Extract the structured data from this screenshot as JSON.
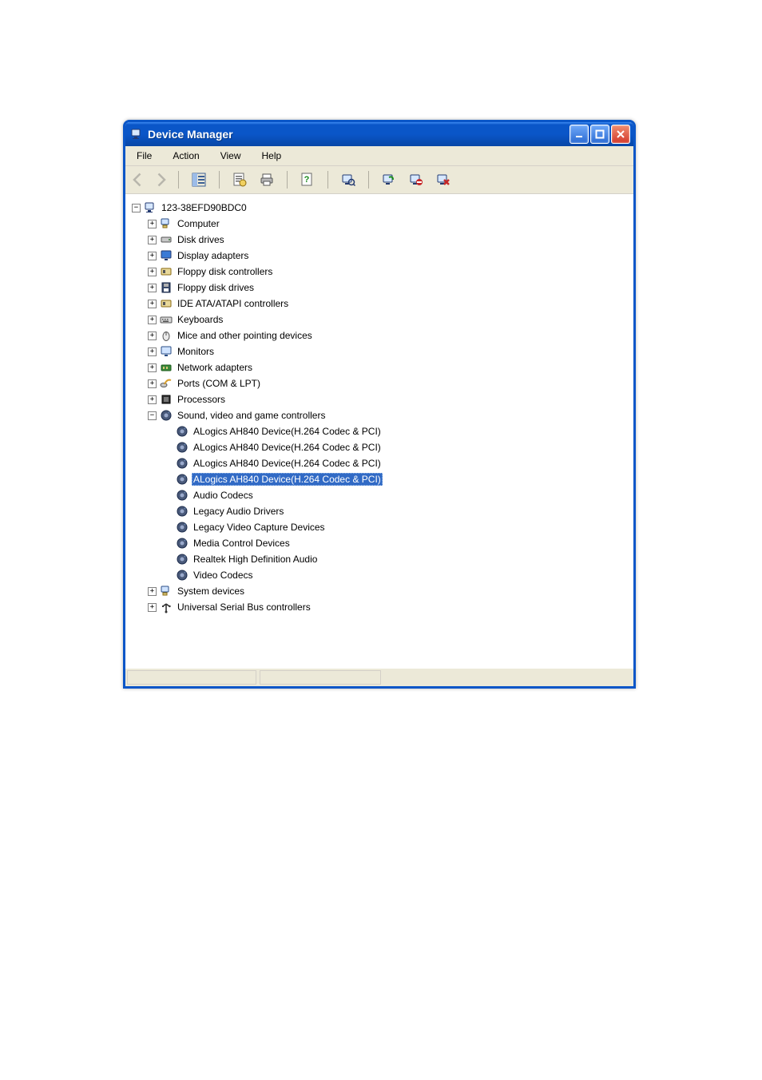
{
  "window": {
    "title": "Device Manager"
  },
  "menubar": {
    "items": [
      "File",
      "Action",
      "View",
      "Help"
    ]
  },
  "toolbar": {
    "icons": [
      "back",
      "forward",
      "show-hide-tree",
      "properties",
      "print",
      "help",
      "scan-hardware",
      "enable",
      "disable",
      "uninstall"
    ]
  },
  "tree": {
    "root": {
      "label": "123-38EFD90BDC0",
      "expanded": true,
      "children": [
        {
          "label": "Computer",
          "icon": "computer",
          "expanded": false
        },
        {
          "label": "Disk drives",
          "icon": "disk",
          "expanded": false
        },
        {
          "label": "Display adapters",
          "icon": "display",
          "expanded": false
        },
        {
          "label": "Floppy disk controllers",
          "icon": "floppy-ctrl",
          "expanded": false
        },
        {
          "label": "Floppy disk drives",
          "icon": "floppy",
          "expanded": false
        },
        {
          "label": "IDE ATA/ATAPI controllers",
          "icon": "ide",
          "expanded": false
        },
        {
          "label": "Keyboards",
          "icon": "keyboard",
          "expanded": false
        },
        {
          "label": "Mice and other pointing devices",
          "icon": "mouse",
          "expanded": false
        },
        {
          "label": "Monitors",
          "icon": "monitor",
          "expanded": false
        },
        {
          "label": "Network adapters",
          "icon": "network",
          "expanded": false
        },
        {
          "label": "Ports (COM & LPT)",
          "icon": "ports",
          "expanded": false
        },
        {
          "label": "Processors",
          "icon": "cpu",
          "expanded": false
        },
        {
          "label": "Sound, video and game controllers",
          "icon": "sound",
          "expanded": true,
          "children": [
            {
              "label": "ALogics AH840 Device(H.264 Codec & PCI)",
              "icon": "sound"
            },
            {
              "label": "ALogics AH840 Device(H.264 Codec & PCI)",
              "icon": "sound"
            },
            {
              "label": "ALogics AH840 Device(H.264 Codec & PCI)",
              "icon": "sound"
            },
            {
              "label": "ALogics AH840 Device(H.264 Codec & PCI)",
              "icon": "sound",
              "selected": true
            },
            {
              "label": "Audio Codecs",
              "icon": "sound"
            },
            {
              "label": "Legacy Audio Drivers",
              "icon": "sound"
            },
            {
              "label": "Legacy Video Capture Devices",
              "icon": "sound"
            },
            {
              "label": "Media Control Devices",
              "icon": "sound"
            },
            {
              "label": "Realtek High Definition Audio",
              "icon": "sound"
            },
            {
              "label": "Video Codecs",
              "icon": "sound"
            }
          ]
        },
        {
          "label": "System devices",
          "icon": "system",
          "expanded": false
        },
        {
          "label": "Universal Serial Bus controllers",
          "icon": "usb",
          "expanded": false
        }
      ]
    }
  }
}
